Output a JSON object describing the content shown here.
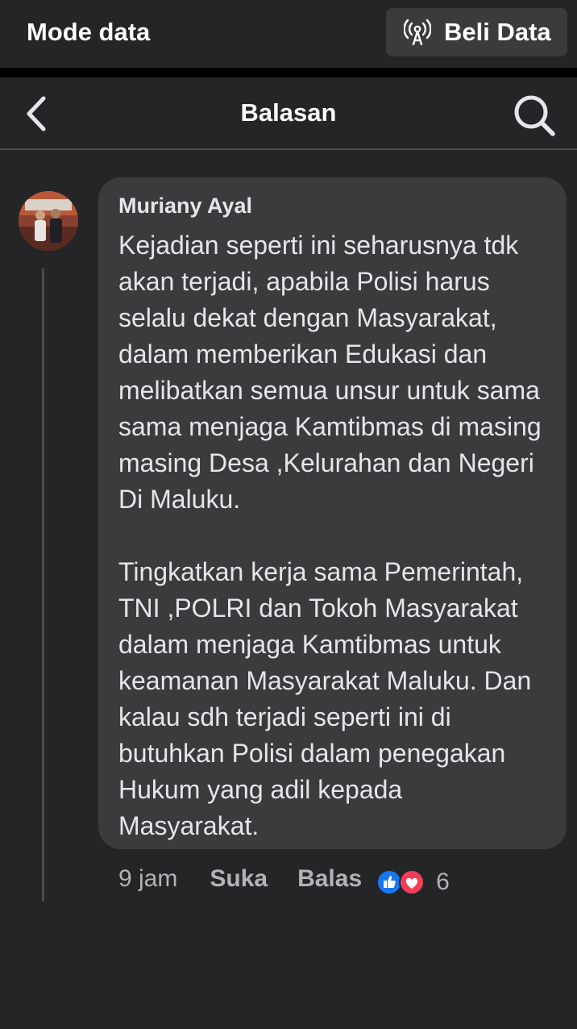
{
  "statusbar": {
    "mode_label": "Mode data",
    "buy_label": "Beli Data"
  },
  "header": {
    "title": "Balasan"
  },
  "comment": {
    "author": "Muriany Ayal",
    "text": "Kejadian seperti ini seharusnya tdk akan terjadi, apabila Polisi harus selalu dekat dengan Masyarakat, dalam memberikan Edukasi dan melibatkan semua unsur untuk sama sama menjaga Kamtibmas di masing masing Desa ,Kelurahan dan Negeri Di Maluku.\n\nTingkatkan kerja sama Pemerintah, TNI ,POLRI dan Tokoh Masyarakat dalam menjaga Kamtibmas untuk keamanan Masyarakat Maluku. Dan kalau sdh terjadi seperti ini di butuhkan Polisi dalam penegakan Hukum yang adil kepada Masyarakat.",
    "time": "9 jam",
    "like_label": "Suka",
    "reply_label": "Balas",
    "reaction_count": "6",
    "reaction_icons": [
      "like-icon",
      "love-icon"
    ]
  },
  "colors": {
    "background": "#242526",
    "bubble": "#3a3b3c",
    "like_blue": "#1877f2",
    "love_red": "#f33e58"
  }
}
